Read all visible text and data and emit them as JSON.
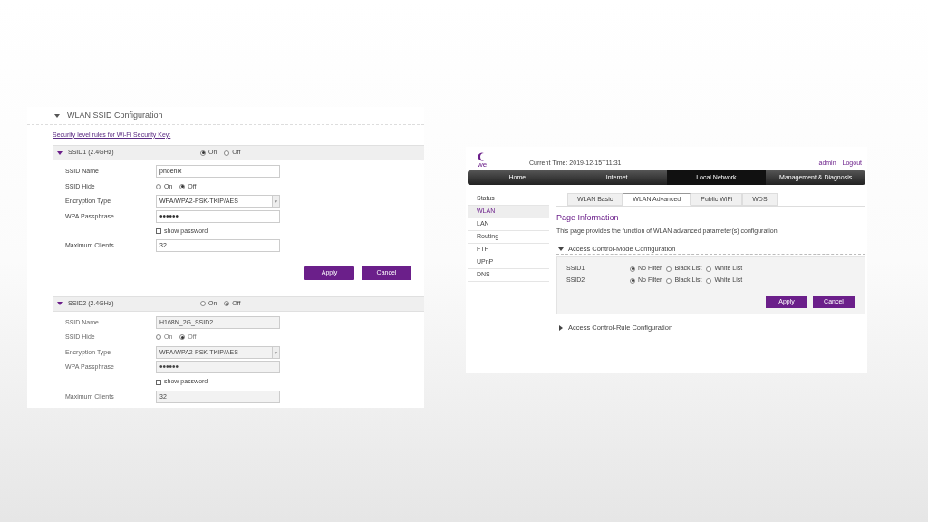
{
  "left": {
    "section_title": "WLAN SSID Configuration",
    "section_expanded": true,
    "security_link": "Security level rules for Wi-Fi Security Key:",
    "ssids": [
      {
        "name": "SSID1 (2.4GHz)",
        "expanded": true,
        "disabled": false,
        "enable_options": [
          {
            "label": "On",
            "selected": true
          },
          {
            "label": "Off",
            "selected": false
          }
        ],
        "fields": [
          {
            "kind": "text",
            "label": "SSID Name",
            "value": "phoenix"
          },
          {
            "kind": "radio",
            "label": "SSID Hide",
            "options": [
              {
                "label": "On",
                "selected": false
              },
              {
                "label": "Off",
                "selected": true
              }
            ]
          },
          {
            "kind": "select",
            "label": "Encryption Type",
            "value": "WPA/WPA2-PSK-TKIP/AES"
          },
          {
            "kind": "password",
            "label": "WPA Passphrase",
            "value": "••••••"
          },
          {
            "kind": "checkbox",
            "label": "show password",
            "checked": false
          },
          {
            "kind": "text",
            "label": "Maximum Clients",
            "value": "32"
          }
        ],
        "buttons": [
          "Apply",
          "Cancel"
        ]
      },
      {
        "name": "SSID2 (2.4GHz)",
        "expanded": true,
        "disabled": true,
        "enable_options": [
          {
            "label": "On",
            "selected": false
          },
          {
            "label": "Off",
            "selected": true
          }
        ],
        "fields": [
          {
            "kind": "text",
            "label": "SSID Name",
            "value": "H168N_2G_SSID2"
          },
          {
            "kind": "radio",
            "label": "SSID Hide",
            "options": [
              {
                "label": "On",
                "selected": false
              },
              {
                "label": "Off",
                "selected": true
              }
            ]
          },
          {
            "kind": "select",
            "label": "Encryption Type",
            "value": "WPA/WPA2-PSK-TKIP/AES"
          },
          {
            "kind": "password",
            "label": "WPA Passphrase",
            "value": "••••••"
          },
          {
            "kind": "checkbox",
            "label": "show password",
            "checked": false
          },
          {
            "kind": "text",
            "label": "Maximum Clients",
            "value": "32"
          }
        ]
      }
    ]
  },
  "right": {
    "logo_text": "we",
    "current_time": "Current Time: 2019-12-15T11:31",
    "user_links": [
      "admin",
      "Logout"
    ],
    "nav": [
      {
        "label": "Home",
        "selected": false
      },
      {
        "label": "Internet",
        "selected": false
      },
      {
        "label": "Local Network",
        "selected": true
      },
      {
        "label": "Management & Diagnosis",
        "selected": false
      }
    ],
    "sidebar": [
      {
        "label": "Status",
        "selected": false
      },
      {
        "label": "WLAN",
        "selected": true
      },
      {
        "label": "LAN",
        "selected": false
      },
      {
        "label": "Routing",
        "selected": false
      },
      {
        "label": "FTP",
        "selected": false
      },
      {
        "label": "UPnP",
        "selected": false
      },
      {
        "label": "DNS",
        "selected": false
      }
    ],
    "tabs": [
      {
        "label": "WLAN Basic",
        "selected": false
      },
      {
        "label": "WLAN Advanced",
        "selected": true
      },
      {
        "label": "Public WiFi",
        "selected": false
      },
      {
        "label": "WDS",
        "selected": false
      }
    ],
    "page_title": "Page Information",
    "page_description": "This page provides the function of WLAN advanced parameter(s) configuration.",
    "sections": [
      {
        "title": "Access Control-Mode Configuration",
        "expanded": true,
        "rows": [
          {
            "label": "SSID1",
            "options": [
              {
                "label": "No Filter",
                "selected": true
              },
              {
                "label": "Black List",
                "selected": false
              },
              {
                "label": "White List",
                "selected": false
              }
            ]
          },
          {
            "label": "SSID2",
            "options": [
              {
                "label": "No Filter",
                "selected": true
              },
              {
                "label": "Black List",
                "selected": false
              },
              {
                "label": "White List",
                "selected": false
              }
            ]
          }
        ],
        "buttons": [
          "Apply",
          "Cancel"
        ]
      },
      {
        "title": "Access Control-Rule Configuration",
        "expanded": false
      }
    ]
  }
}
